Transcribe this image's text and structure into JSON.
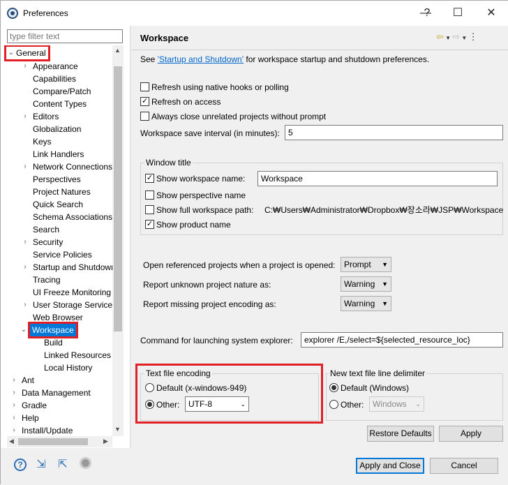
{
  "window": {
    "title": "Preferences",
    "help": "?",
    "minimize": "—",
    "maximize": "☐",
    "close": "✕"
  },
  "filter": {
    "placeholder": "type filter text"
  },
  "tree": {
    "general": "General",
    "items": [
      "Appearance",
      "Capabilities",
      "Compare/Patch",
      "Content Types",
      "Editors",
      "Globalization",
      "Keys",
      "Link Handlers",
      "Network Connections",
      "Perspectives",
      "Project Natures",
      "Quick Search",
      "Schema Associations",
      "Search",
      "Security",
      "Service Policies",
      "Startup and Shutdown",
      "Tracing",
      "UI Freeze Monitoring",
      "User Storage Service",
      "Web Browser"
    ],
    "workspace": "Workspace",
    "ws_children": [
      "Build",
      "Linked Resources",
      "Local History"
    ],
    "top": [
      "Ant",
      "Data Management",
      "Gradle",
      "Help",
      "Install/Update"
    ]
  },
  "page": {
    "title": "Workspace",
    "intro_prefix": "See ",
    "intro_link": "'Startup and Shutdown'",
    "intro_suffix": " for workspace startup and shutdown preferences.",
    "refresh_native": "Refresh using native hooks or polling",
    "refresh_access": "Refresh on access",
    "always_close": "Always close unrelated projects without prompt",
    "save_interval_label": "Workspace save interval (in minutes):",
    "save_interval_value": "5",
    "window_title": {
      "legend": "Window title",
      "show_ws_name": "Show workspace name:",
      "ws_name_value": "Workspace",
      "show_perspective": "Show perspective name",
      "show_full_path": "Show full workspace path:",
      "full_path_value": "C:₩Users₩Administrator₩Dropbox₩장소라₩JSP₩Workspace",
      "show_product": "Show product name"
    },
    "open_ref_label": "Open referenced projects when a project is opened:",
    "open_ref_value": "Prompt",
    "report_nature_label": "Report unknown project nature as:",
    "report_nature_value": "Warning",
    "report_encoding_label": "Report missing project encoding as:",
    "report_encoding_value": "Warning",
    "cmd_label": "Command for launching system explorer:",
    "cmd_value": "explorer /E,/select=${selected_resource_loc}",
    "encoding": {
      "legend": "Text file encoding",
      "default": "Default (x-windows-949)",
      "other": "Other:",
      "other_value": "UTF-8"
    },
    "delimiter": {
      "legend": "New text file line delimiter",
      "default": "Default (Windows)",
      "other": "Other:",
      "other_value": "Windows"
    },
    "restore": "Restore Defaults",
    "apply": "Apply"
  },
  "footer": {
    "apply_close": "Apply and Close",
    "cancel": "Cancel"
  },
  "icons": [
    "help-icon",
    "import-icon",
    "export-icon",
    "oomph-icon"
  ]
}
